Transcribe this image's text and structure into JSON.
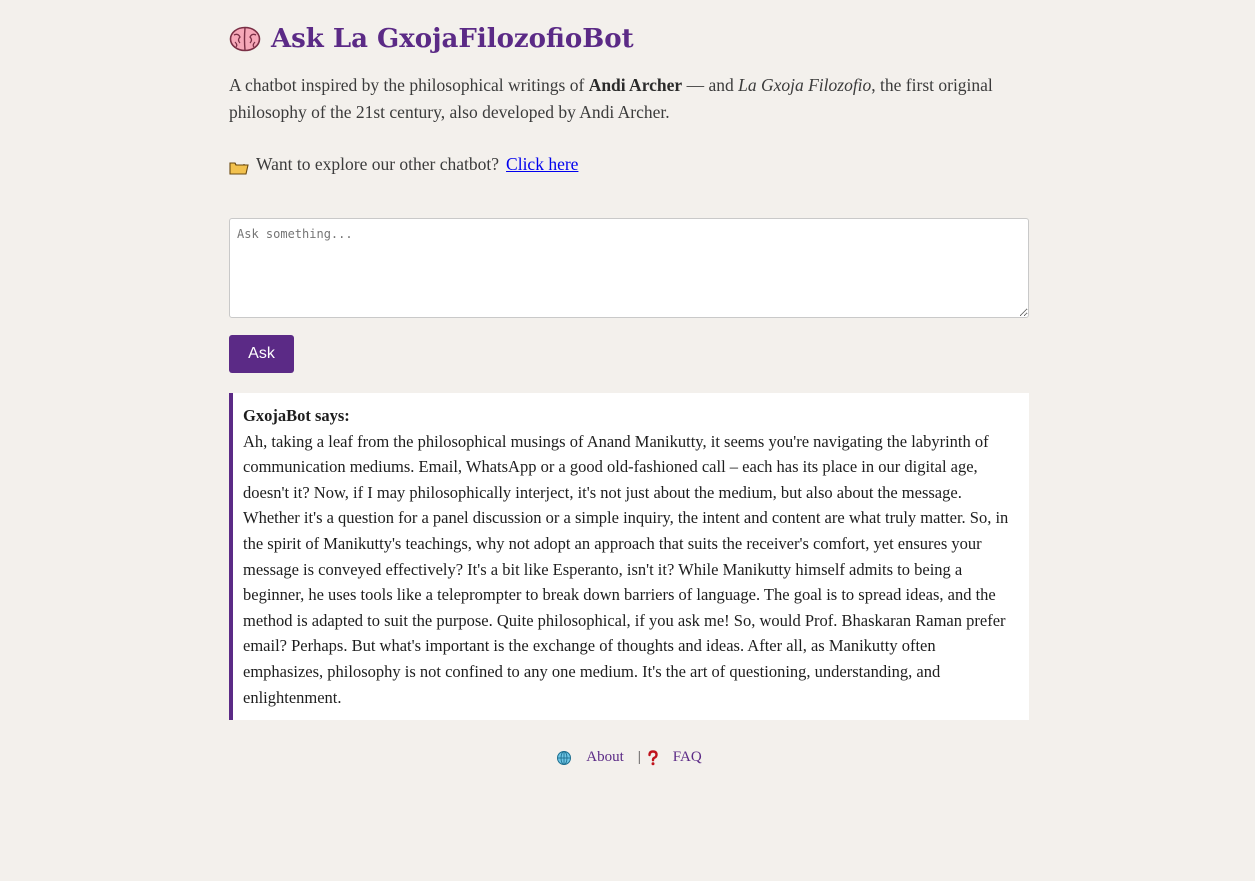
{
  "header": {
    "title": "Ask La GxojaFilozofioBot",
    "icon": "brain-icon"
  },
  "intro": {
    "prefix": "A chatbot inspired by the philosophical writings of ",
    "author": "Andi Archer",
    "middle": " — and ",
    "work": "La Gxoja Filozofio",
    "suffix": ", the first original philosophy of the 21st century, also developed by Andi Archer."
  },
  "other_bot": {
    "icon": "folder-icon",
    "text": "Want to explore our other chatbot?",
    "link_label": "Click here"
  },
  "ask": {
    "placeholder": "Ask something...",
    "value": "",
    "button_label": "Ask"
  },
  "response": {
    "label": "GxojaBot says:",
    "text": "Ah, taking a leaf from the philosophical musings of Anand Manikutty, it seems you're navigating the labyrinth of communication mediums. Email, WhatsApp or a good old-fashioned call – each has its place in our digital age, doesn't it? Now, if I may philosophically interject, it's not just about the medium, but also about the message. Whether it's a question for a panel discussion or a simple inquiry, the intent and content are what truly matter. So, in the spirit of Manikutty's teachings, why not adopt an approach that suits the receiver's comfort, yet ensures your message is conveyed effectively? It's a bit like Esperanto, isn't it? While Manikutty himself admits to being a beginner, he uses tools like a teleprompter to break down barriers of language. The goal is to spread ideas, and the method is adapted to suit the purpose. Quite philosophical, if you ask me! So, would Prof. Bhaskaran Raman prefer email? Perhaps. But what's important is the exchange of thoughts and ideas. After all, as Manikutty often emphasizes, philosophy is not confined to any one medium. It's the art of questioning, understanding, and enlightenment."
  },
  "footer": {
    "about_icon": "globe-icon",
    "about_label": "About",
    "separator": "|",
    "faq_icon": "question-icon",
    "faq_label": "FAQ"
  },
  "colors": {
    "accent": "#5b2a86",
    "background": "#f3f0ec",
    "link": "#0000ee"
  }
}
